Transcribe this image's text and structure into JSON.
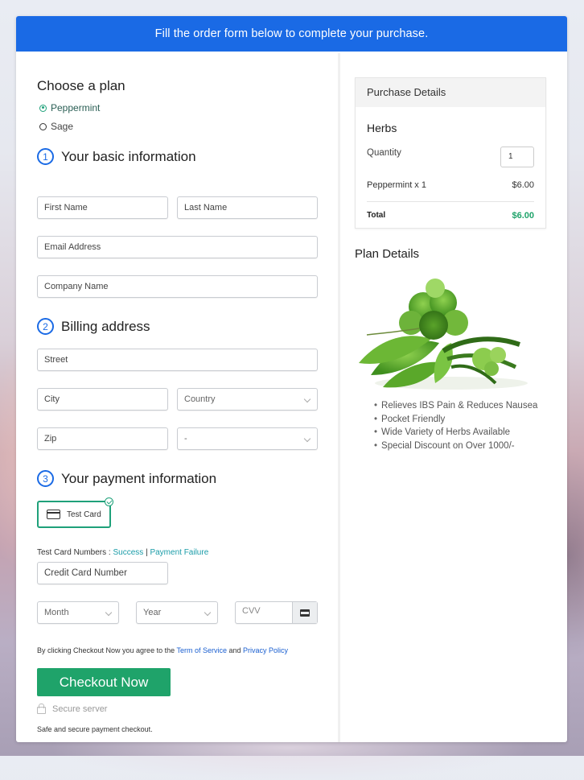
{
  "banner": {
    "text": "Fill the order form below to complete your purchase."
  },
  "plan": {
    "heading": "Choose a plan",
    "options": [
      {
        "label": "Peppermint",
        "selected": true
      },
      {
        "label": "Sage",
        "selected": false
      }
    ]
  },
  "basic_info": {
    "step_number": "1",
    "heading": "Your basic information",
    "first_name_placeholder": "First Name",
    "last_name_placeholder": "Last Name",
    "email_placeholder": "Email Address",
    "company_placeholder": "Company Name"
  },
  "billing": {
    "step_number": "2",
    "heading": "Billing address",
    "street_placeholder": "Street",
    "city_placeholder": "City",
    "country_selected": "Country",
    "zip_placeholder": "Zip",
    "state_selected": "-"
  },
  "payment": {
    "step_number": "3",
    "heading": "Your payment information",
    "method_label": "Test Card",
    "test_numbers_label": "Test Card Numbers :",
    "success_link": "Success",
    "separator": "|",
    "failure_link": "Payment Failure",
    "card_number_placeholder": "Credit Card Number",
    "month_selected": "Month",
    "year_selected": "Year",
    "cvv_placeholder": "CVV"
  },
  "agreement": {
    "prefix": "By clicking Checkout Now you agree to the",
    "terms_link": "Term of Service",
    "and": "and",
    "privacy_link": "Privacy Policy"
  },
  "checkout": {
    "button_label": "Checkout Now",
    "secure_label": "Secure server",
    "safe_text": "Safe and secure payment checkout."
  },
  "purchase_details": {
    "heading": "Purchase Details",
    "product": "Herbs",
    "quantity_label": "Quantity",
    "quantity_value": "1",
    "line_item": "Peppermint x 1",
    "line_price": "$6.00",
    "total_label": "Total",
    "total_value": "$6.00"
  },
  "plan_details": {
    "heading": "Plan Details",
    "image_alt": "herbs-bundle",
    "features": [
      "Relieves IBS Pain & Reduces Nausea",
      "Pocket Friendly",
      "Wide Variety of Herbs Available",
      "Special Discount on Over 1000/-"
    ]
  },
  "colors": {
    "primary_blue": "#1a6ae5",
    "checkout_green": "#1fa36a",
    "link_teal": "#1a9ca8"
  }
}
